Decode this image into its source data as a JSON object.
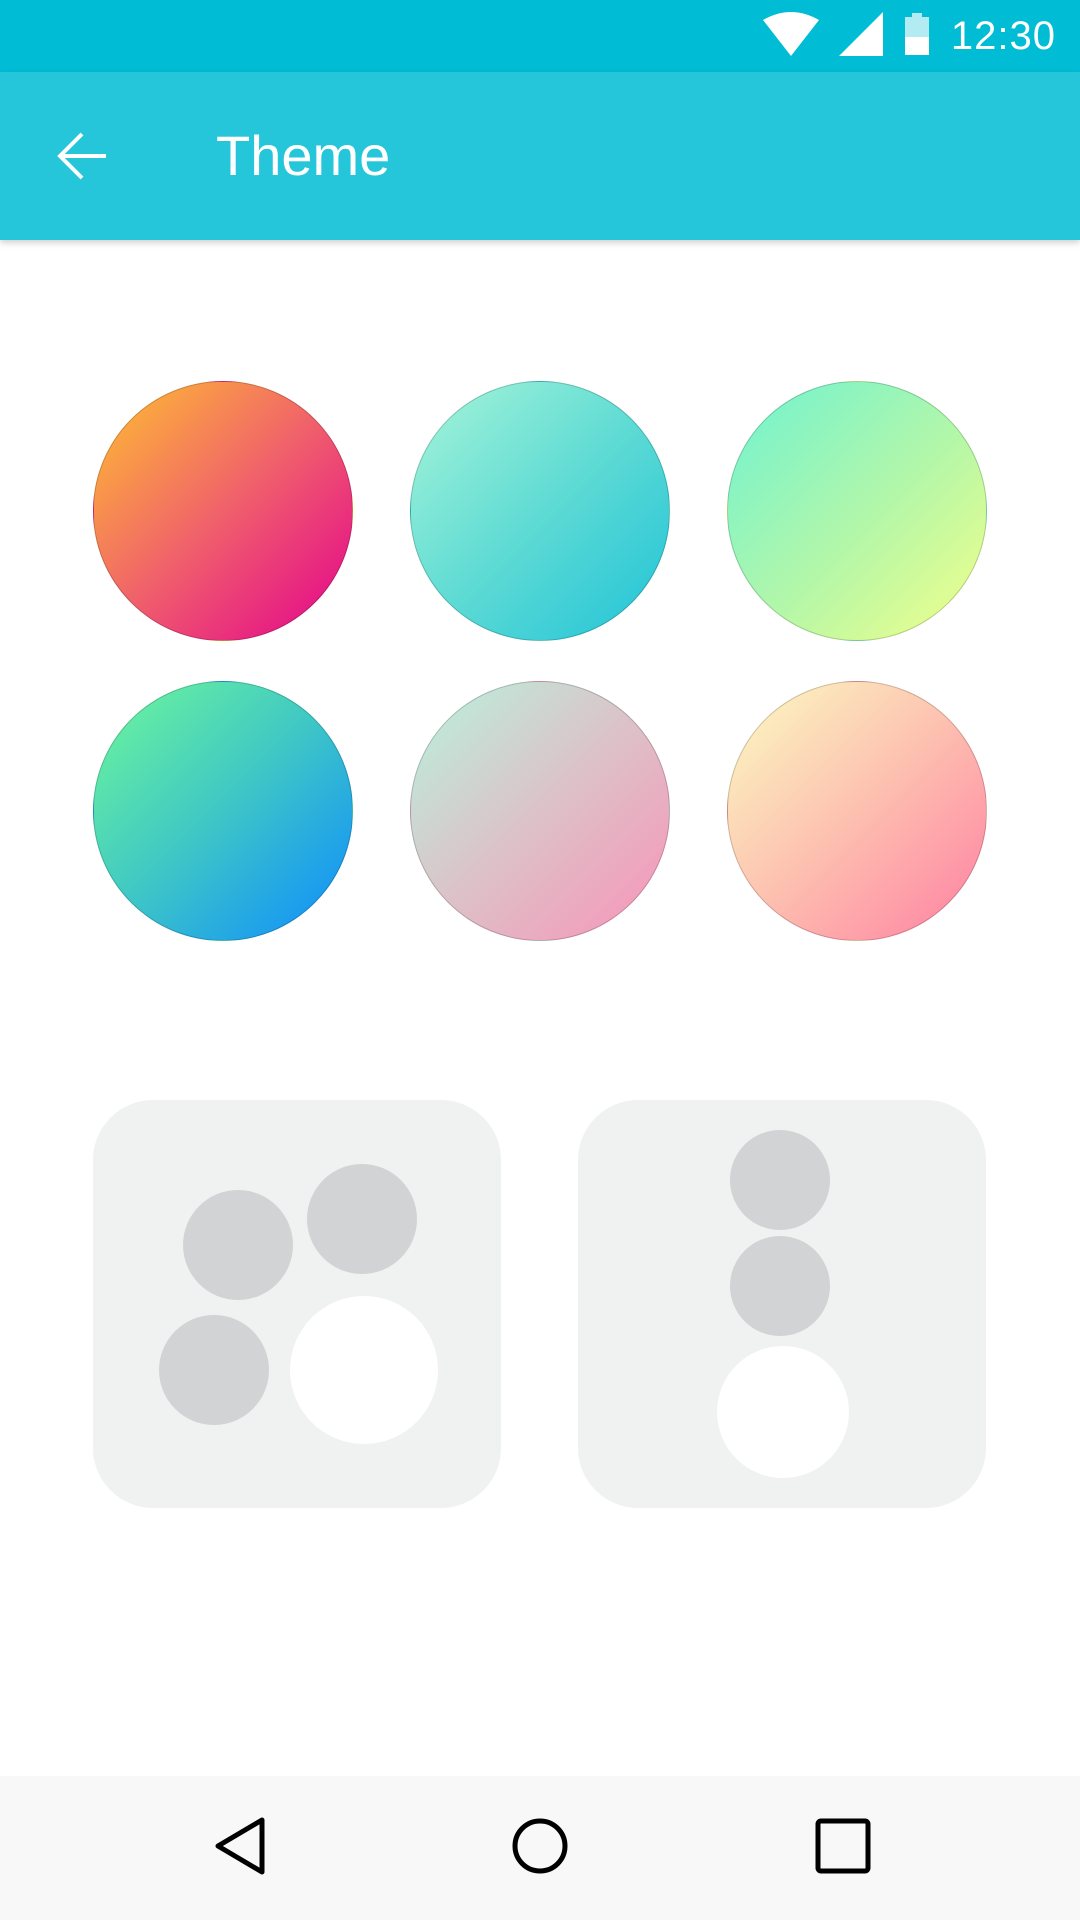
{
  "status_bar": {
    "time": "12:30",
    "icons": [
      "wifi-icon",
      "cell-signal-icon",
      "battery-icon"
    ]
  },
  "app_bar": {
    "title": "Theme",
    "back_icon": "arrow-left-icon",
    "background": "#26c6da"
  },
  "swatches": [
    {
      "name": "sunset",
      "colors": [
        "#ffc130",
        "#e3008e"
      ]
    },
    {
      "name": "aqua",
      "colors": [
        "#a8f5d8",
        "#20c3d8"
      ]
    },
    {
      "name": "lime-mint",
      "colors": [
        "#6ff2d2",
        "#f4ff8a"
      ]
    },
    {
      "name": "green-blue",
      "colors": [
        "#6ff89a",
        "#0c8bff"
      ]
    },
    {
      "name": "mint-pink",
      "colors": [
        "#b8f2dc",
        "#f993b8"
      ]
    },
    {
      "name": "cream-rose",
      "colors": [
        "#fbfcc2",
        "#ff7fa2"
      ]
    }
  ],
  "layout_options": [
    "cluster-layout",
    "column-layout"
  ],
  "nav_bar": {
    "icons": [
      "back-triangle-icon",
      "home-circle-icon",
      "recents-square-icon"
    ]
  }
}
